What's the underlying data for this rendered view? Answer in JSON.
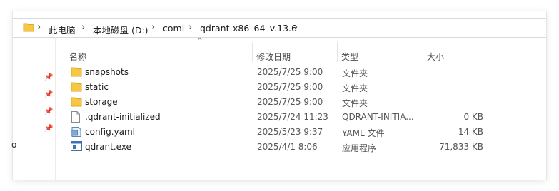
{
  "breadcrumb": {
    "items": [
      "此电脑",
      "本地磁盘 (D:)",
      "comi",
      "qdrant-x86_64_v.13.6"
    ]
  },
  "columns": {
    "name": "名称",
    "date": "修改日期",
    "type": "类型",
    "size": "大小"
  },
  "files": [
    {
      "name": "snapshots",
      "date": "2025/7/25 9:00",
      "type": "文件夹",
      "size": "",
      "icon": "folder-icon"
    },
    {
      "name": "static",
      "date": "2025/7/25 9:00",
      "type": "文件夹",
      "size": "",
      "icon": "folder-icon"
    },
    {
      "name": "storage",
      "date": "2025/7/25 9:00",
      "type": "文件夹",
      "size": "",
      "icon": "folder-icon"
    },
    {
      "name": ".qdrant-initialized",
      "date": "2025/7/24 11:23",
      "type": "QDRANT-INITIA...",
      "size": "0 KB",
      "icon": "file-icon"
    },
    {
      "name": "config.yaml",
      "date": "2025/5/23 9:37",
      "type": "YAML 文件",
      "size": "14 KB",
      "icon": "yaml-file-icon"
    },
    {
      "name": "qdrant.exe",
      "date": "2025/4/1 8:06",
      "type": "应用程序",
      "size": "71,833 KB",
      "icon": "exe-file-icon"
    }
  ],
  "edge_text": "o",
  "colors": {
    "folder": "#f6c744",
    "folder_dark": "#e0a92a",
    "window_border": "#e6e6e6"
  }
}
